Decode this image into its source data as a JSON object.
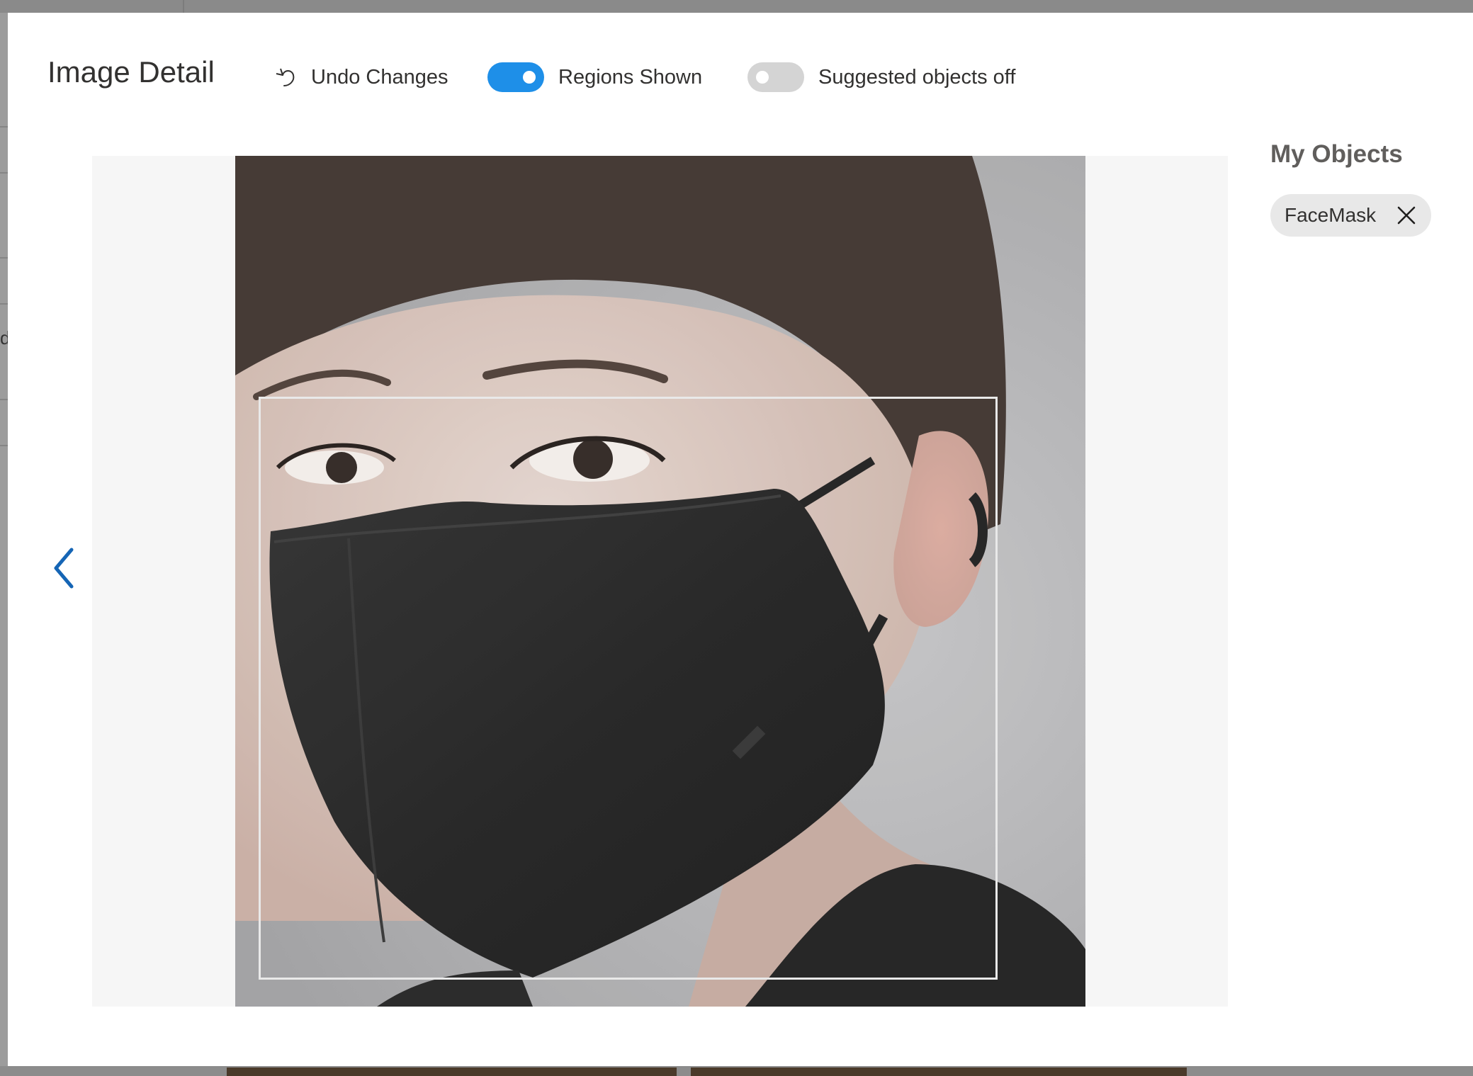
{
  "header": {
    "title": "Image Detail",
    "undo_label": "Undo Changes",
    "regions_toggle": {
      "label": "Regions Shown",
      "state": "on"
    },
    "suggested_toggle": {
      "label": "Suggested objects off",
      "state": "off"
    }
  },
  "viewer": {
    "image_subject": "person wearing black face mask",
    "region_tag": "FaceMask"
  },
  "sidebar": {
    "title": "My Objects",
    "tags": [
      {
        "label": "FaceMask"
      }
    ]
  },
  "background": {
    "fragment_text": "d"
  },
  "colors": {
    "accent": "#1e8fe8",
    "nav_arrow": "#1565b5",
    "toggle_off": "#d4d4d4",
    "tag_bg": "#e8e8e8"
  },
  "icons": {
    "undo": "undo-icon",
    "prev": "chevron-left-icon",
    "remove_tag": "close-icon"
  }
}
